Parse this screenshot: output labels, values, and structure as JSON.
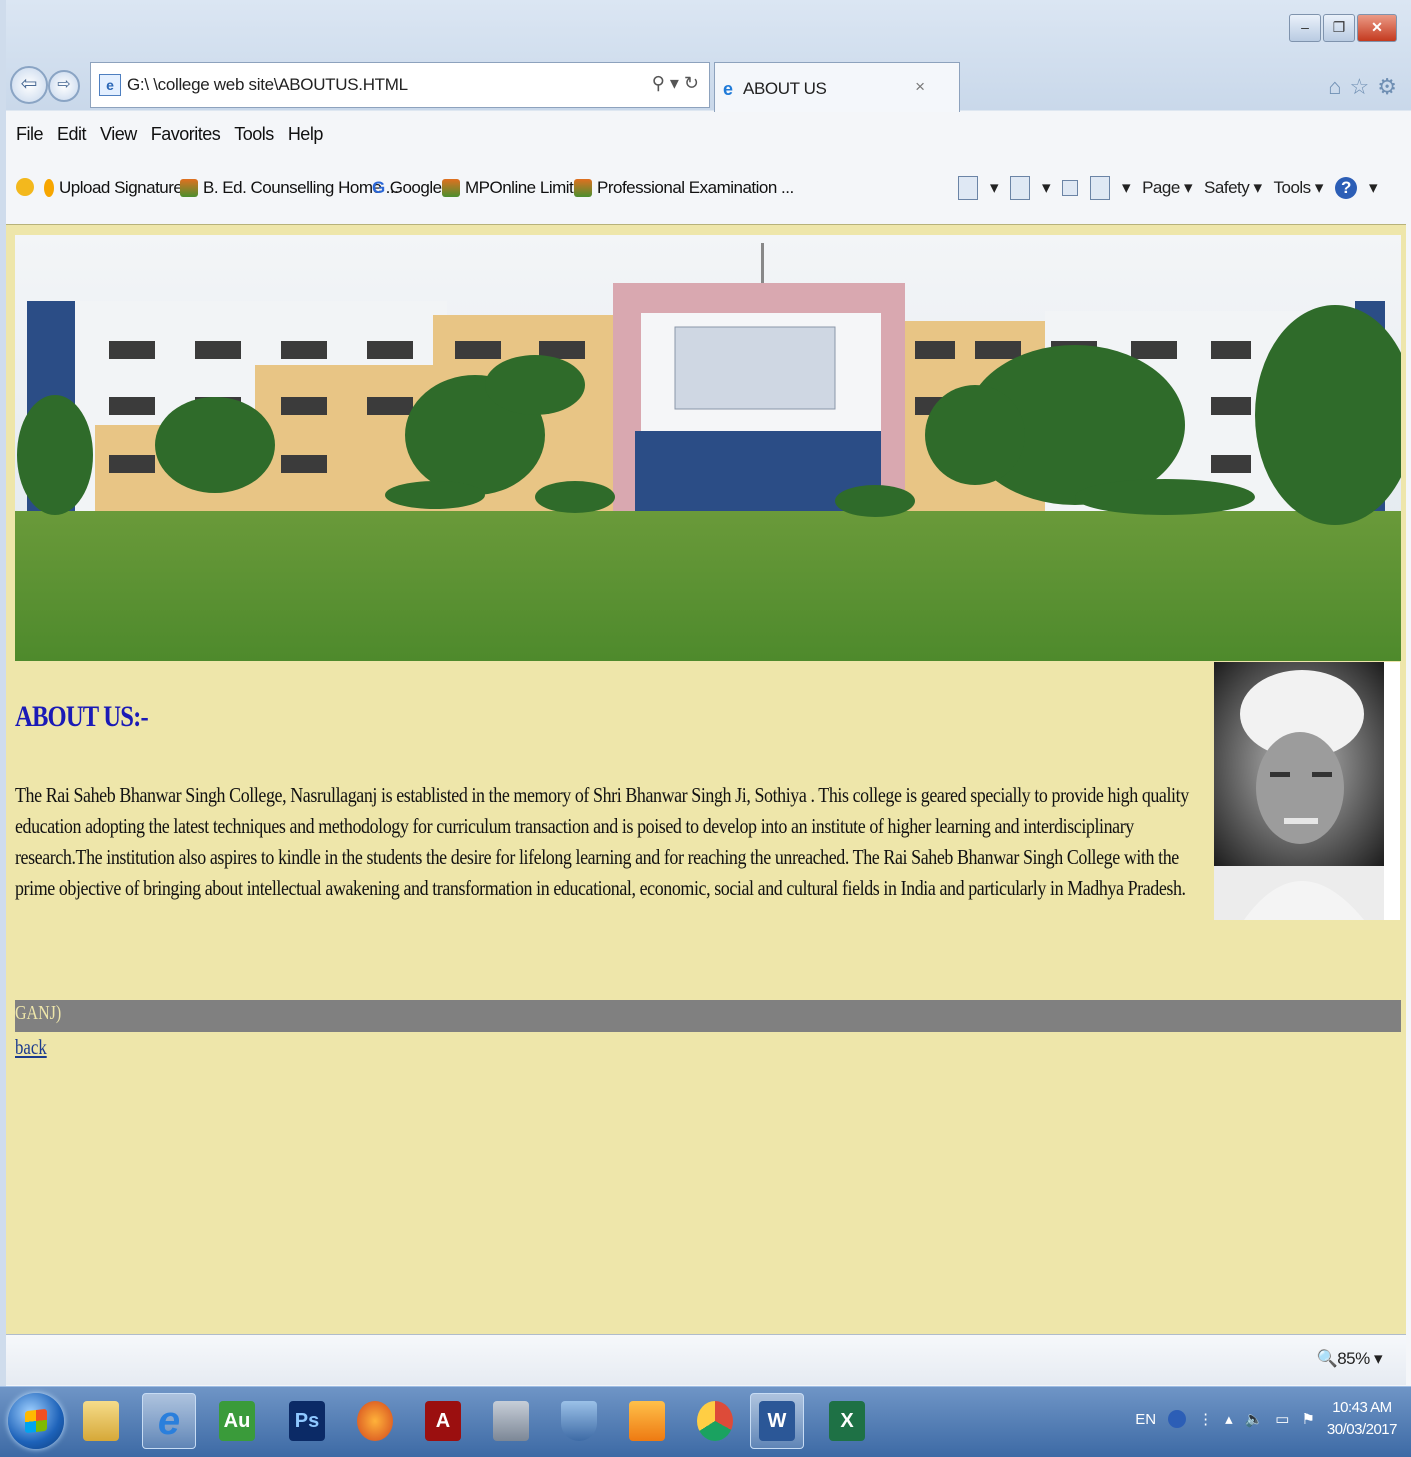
{
  "browser": {
    "address_url": "G:\\ \\college web site\\ABOUTUS.HTML",
    "search_glyph": "⚲ ▾ ↻",
    "tab_title": "ABOUT US",
    "tab_close": "×",
    "back_glyph": "⇦",
    "forward_glyph": "⇨",
    "right_icons": [
      "⌂",
      "☆",
      "⚙"
    ],
    "window_controls": {
      "minimize": "–",
      "maximize": "❐",
      "close": "✕"
    },
    "menu": [
      "File",
      "Edit",
      "View",
      "Favorites",
      "Tools",
      "Help"
    ],
    "favorites": [
      {
        "label": "Upload Signature",
        "icon": "upload-icon",
        "color": "#e0a000"
      },
      {
        "label": "B. Ed. Counselling Home ...",
        "icon": "mponline-icon",
        "color": "#4c8f2f"
      },
      {
        "label": "Google",
        "icon": "google-icon",
        "color": "#2b67d6"
      },
      {
        "label": "MPOnline Limited",
        "icon": "mponline-icon",
        "color": "#4c8f2f"
      },
      {
        "label": "Professional Examination ...",
        "icon": "mponline-icon",
        "color": "#4c8f2f"
      }
    ],
    "command_bar": {
      "page": "Page ▾",
      "safety": "Safety ▾",
      "tools": "Tools ▾",
      "help": "?"
    },
    "zoom": "🔍85%   ▾"
  },
  "page": {
    "about_title": "ABOUT US:-",
    "about_text": "The Rai Saheb Bhanwar Singh College, Nasrullaganj is establisted in the memory of Shri Bhanwar Singh Ji, Sothiya . This college is  geared specially to provide high quality education adopting the latest techniques and methodology for curriculum transaction and is poised to develop into an institute of higher learning and interdisciplinary research.The institution also aspires to kindle in the students the desire for lifelong learning and for reaching the unreached. The Rai Saheb Bhanwar Singh College with the prime objective of bringing about intellectual awakening and transformation in educational, economic, social and cultural fields in India and particularly in Madhya Pradesh.",
    "footer_text": "GANJ)",
    "back_link": "back",
    "background_color": "#eee6aa",
    "title_color": "#1a1ab6"
  },
  "taskbar": {
    "apps": [
      {
        "name": "explorer",
        "label": "",
        "icon": "folder-icon",
        "color": "#e8c35a"
      },
      {
        "name": "internet-explorer",
        "label": "e",
        "icon": "internet-explorer-icon",
        "color": "#2a7fdc"
      },
      {
        "name": "app-green",
        "label": "Au",
        "icon": "app-icon",
        "color": "#3a9b3a"
      },
      {
        "name": "photoshop",
        "label": "Ps",
        "icon": "photoshop-icon",
        "color": "#1e3a8a"
      },
      {
        "name": "firefox",
        "label": "",
        "icon": "firefox-icon",
        "color": "#e66a1d"
      },
      {
        "name": "acrobat",
        "label": "A",
        "icon": "acrobat-icon",
        "color": "#b01010"
      },
      {
        "name": "device-manager",
        "label": "",
        "icon": "device-icon",
        "color": "#8a96a8"
      },
      {
        "name": "shield-app",
        "label": "",
        "icon": "shield-icon",
        "color": "#5b7fb0"
      },
      {
        "name": "uc-browser",
        "label": "",
        "icon": "uc-browser-icon",
        "color": "#f08a1c"
      },
      {
        "name": "chrome",
        "label": "",
        "icon": "chrome-icon",
        "color": "#dd4b39"
      },
      {
        "name": "word",
        "label": "W",
        "icon": "word-icon",
        "color": "#2b5797"
      },
      {
        "name": "excel",
        "label": "X",
        "icon": "excel-icon",
        "color": "#1e7145"
      }
    ],
    "tray_lang": "EN",
    "time": "10:43 AM",
    "date": "30/03/2017"
  }
}
